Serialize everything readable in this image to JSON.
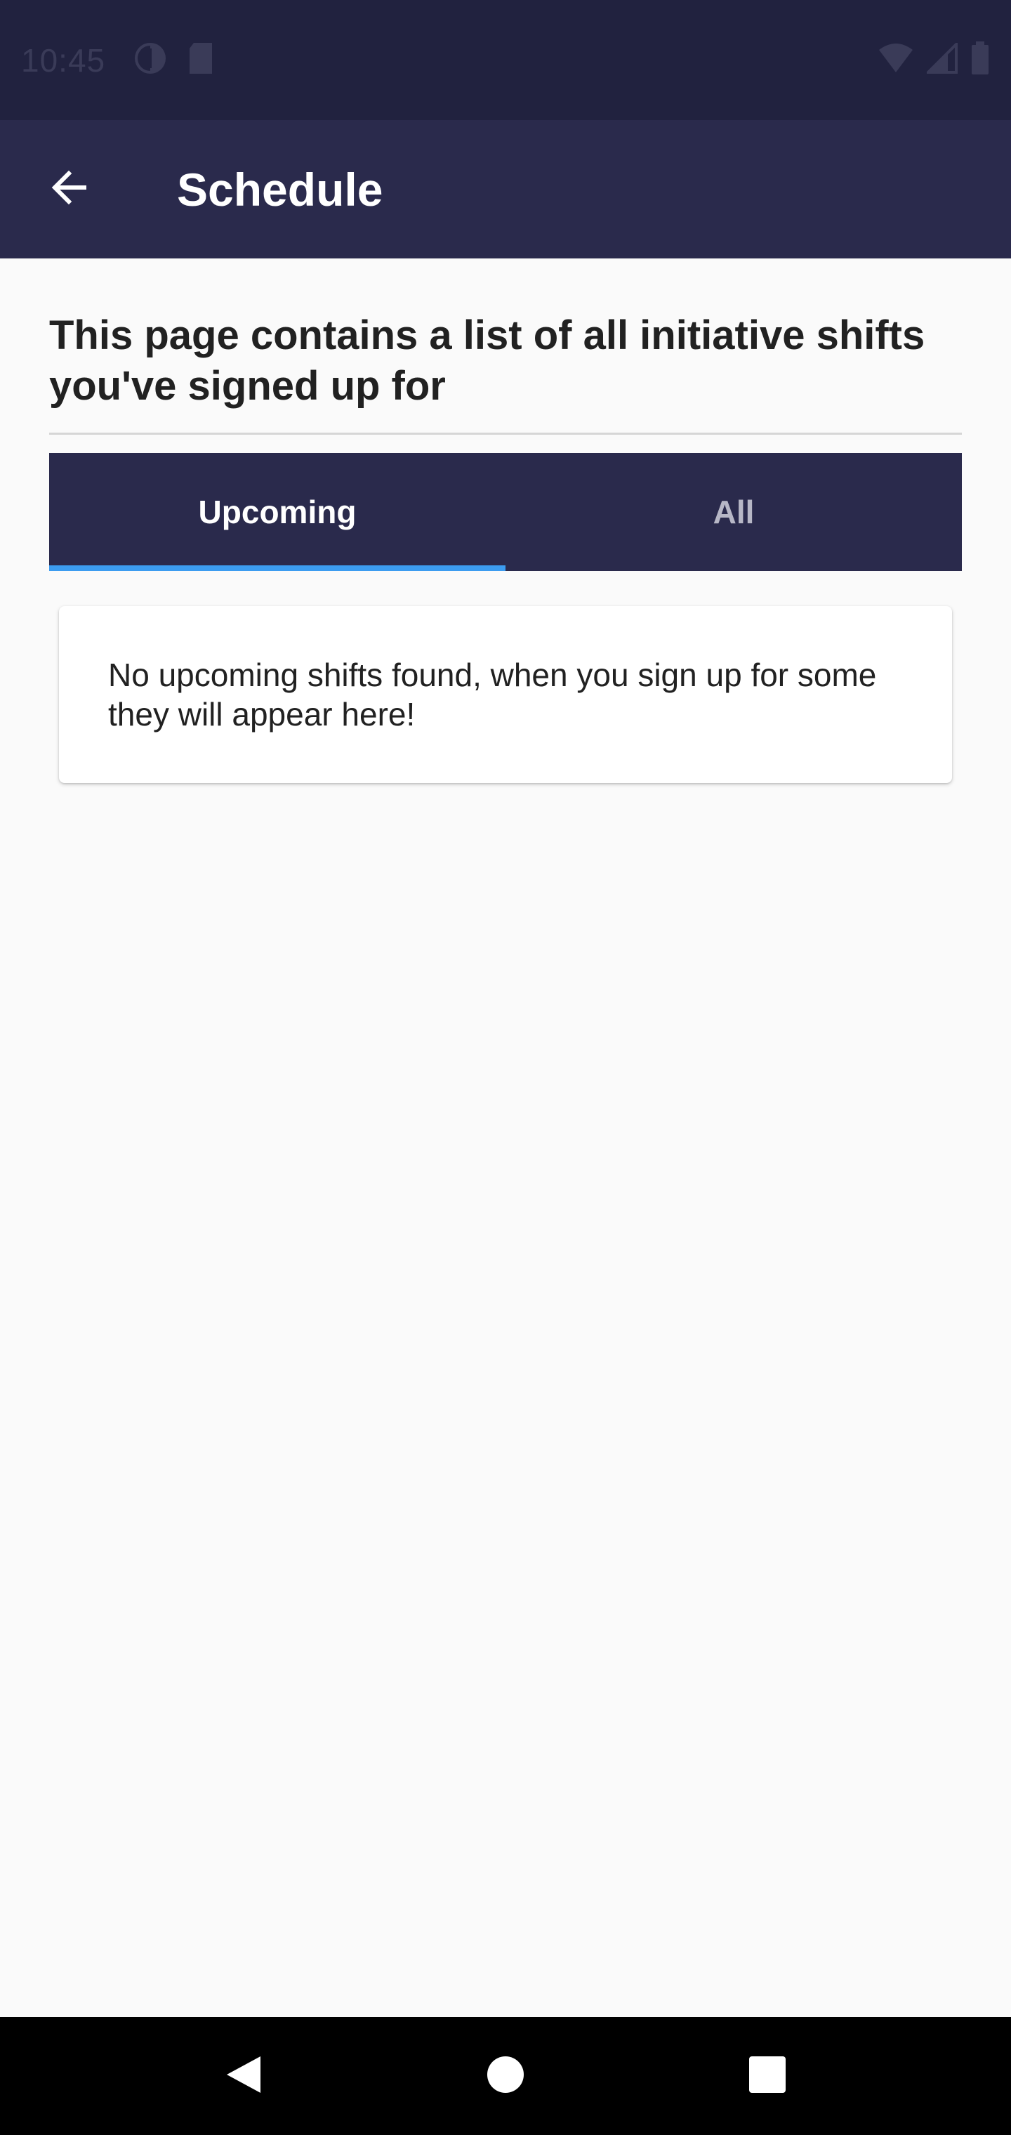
{
  "status_bar": {
    "time": "10:45",
    "left_icons": [
      "data-saver-icon",
      "sd-card-icon"
    ],
    "right_icons": [
      "wifi-icon",
      "cell-signal-icon",
      "battery-icon"
    ]
  },
  "app_bar": {
    "back_icon": "arrow-back-icon",
    "title": "Schedule",
    "background": "#2a2a4c"
  },
  "intro": {
    "text": "This page contains a list of all initiative shifts you've signed up for"
  },
  "tabs": [
    {
      "label": "Upcoming",
      "selected": true
    },
    {
      "label": "All",
      "selected": false
    }
  ],
  "tab_indicator_color": "#3c9cf0",
  "empty_state": {
    "message": "No upcoming shifts found, when you sign up for some they will appear here!"
  },
  "nav_bar": {
    "buttons": [
      "back-triangle-icon",
      "home-circle-icon",
      "recents-square-icon"
    ]
  }
}
